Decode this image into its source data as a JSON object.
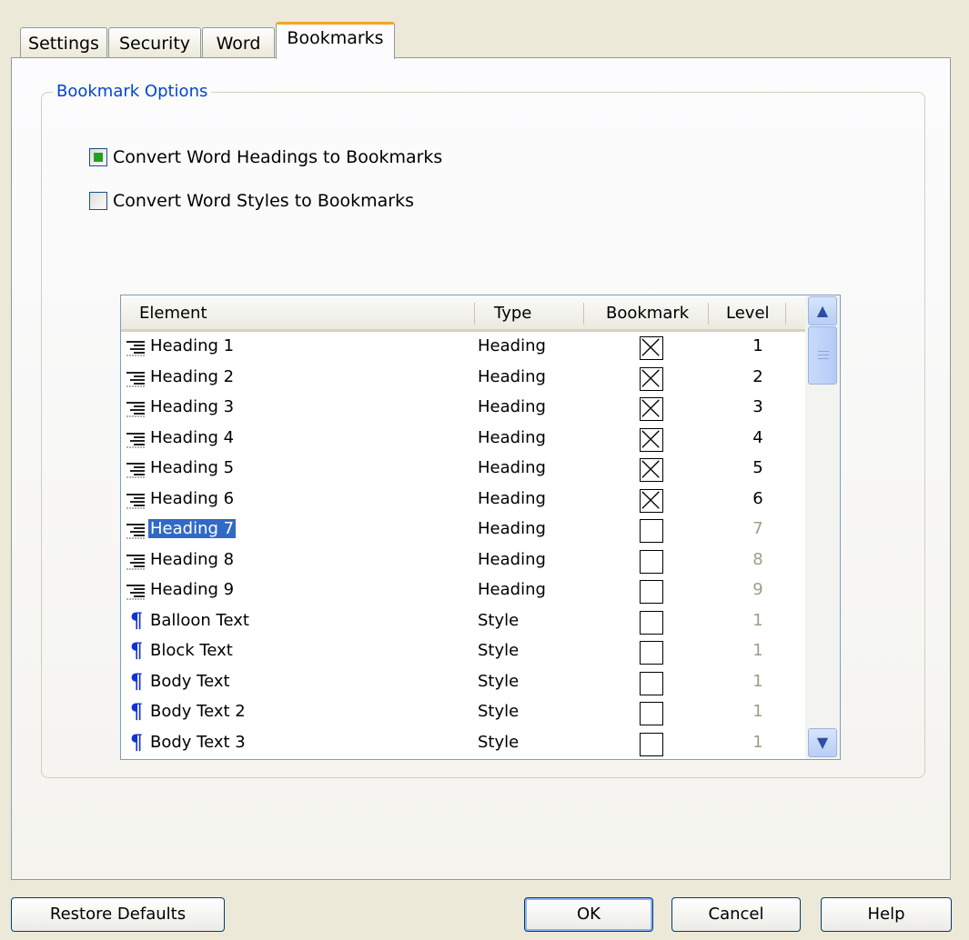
{
  "tabs": [
    {
      "label": "Settings"
    },
    {
      "label": "Security"
    },
    {
      "label": "Word"
    },
    {
      "label": "Bookmarks"
    }
  ],
  "group": {
    "title": "Bookmark Options"
  },
  "options": {
    "headings_label": "Convert Word Headings to Bookmarks",
    "headings_checked": true,
    "styles_label": "Convert Word Styles to Bookmarks",
    "styles_checked": false
  },
  "table": {
    "columns": [
      "Element",
      "Type",
      "Bookmark",
      "Level"
    ],
    "rows": [
      {
        "element": "Heading 1",
        "type": "Heading",
        "bookmark": true,
        "level": "1",
        "kind": "heading"
      },
      {
        "element": "Heading 2",
        "type": "Heading",
        "bookmark": true,
        "level": "2",
        "kind": "heading"
      },
      {
        "element": "Heading 3",
        "type": "Heading",
        "bookmark": true,
        "level": "3",
        "kind": "heading"
      },
      {
        "element": "Heading 4",
        "type": "Heading",
        "bookmark": true,
        "level": "4",
        "kind": "heading"
      },
      {
        "element": "Heading 5",
        "type": "Heading",
        "bookmark": true,
        "level": "5",
        "kind": "heading"
      },
      {
        "element": "Heading 6",
        "type": "Heading",
        "bookmark": true,
        "level": "6",
        "kind": "heading"
      },
      {
        "element": "Heading 7",
        "type": "Heading",
        "bookmark": false,
        "level": "7",
        "kind": "heading",
        "selected": true
      },
      {
        "element": "Heading 8",
        "type": "Heading",
        "bookmark": false,
        "level": "8",
        "kind": "heading"
      },
      {
        "element": "Heading 9",
        "type": "Heading",
        "bookmark": false,
        "level": "9",
        "kind": "heading"
      },
      {
        "element": "Balloon Text",
        "type": "Style",
        "bookmark": false,
        "level": "1",
        "kind": "style"
      },
      {
        "element": "Block Text",
        "type": "Style",
        "bookmark": false,
        "level": "1",
        "kind": "style"
      },
      {
        "element": "Body Text",
        "type": "Style",
        "bookmark": false,
        "level": "1",
        "kind": "style"
      },
      {
        "element": "Body Text 2",
        "type": "Style",
        "bookmark": false,
        "level": "1",
        "kind": "style"
      },
      {
        "element": "Body Text 3",
        "type": "Style",
        "bookmark": false,
        "level": "1",
        "kind": "style"
      }
    ]
  },
  "buttons": {
    "restore": "Restore Defaults",
    "ok": "OK",
    "cancel": "Cancel",
    "help": "Help"
  },
  "colors": {
    "accent": "#0046d5",
    "selection": "#316ac5",
    "tab_highlight": "#f5a622",
    "check_fill": "#21a121"
  }
}
